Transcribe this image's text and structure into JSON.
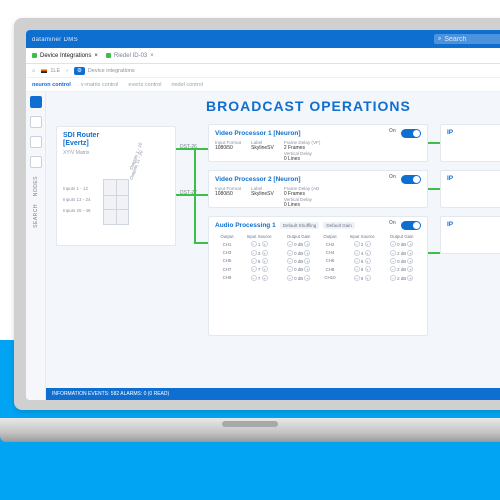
{
  "topbar": {
    "brand": "dataminer",
    "suite": "DMS",
    "search_placeholder": "Search",
    "square_icon": "□"
  },
  "tabs": [
    {
      "label": "Device Integrations",
      "close": "×"
    },
    {
      "label": "Riedel ID-03",
      "close": "×"
    }
  ],
  "crumbs": {
    "home": "⌂",
    "flag": "1LE",
    "badge_icon": "⚙",
    "badge": "Device integrations"
  },
  "subnav": [
    "neuron control",
    "v-matrix control",
    "evertz control",
    "riedel control"
  ],
  "rail": {
    "items": [
      "1",
      "2",
      "3",
      "4"
    ],
    "vertical1": "NODES",
    "vertical2": "SEARCH"
  },
  "headline": "BROADCAST OPERATIONS",
  "sdi": {
    "title": "SDI Router",
    "vendor": "[Evertz]",
    "sub": "XY\\V Matrix",
    "inputs": [
      "Inputs 1 - 12",
      "Inputs 13 - 24",
      "Inputs 25 - 48"
    ],
    "outputs": [
      "Outputs 1 - 10",
      "Outputs 11 - 20"
    ]
  },
  "dst": [
    "DST-26",
    "DST-27"
  ],
  "video": [
    {
      "title": "Video Processor 1 [Neuron]",
      "on": "On",
      "format_h": "Input Format",
      "format": "1080i50",
      "label_h": "Label",
      "label": "SkylineSV",
      "delay_h": "Frame Delay (VF)",
      "delay": "2 Frames",
      "vd_h": "Vertical Delay",
      "vd": "0 Lines"
    },
    {
      "title": "Video Processor 2 [Neuron]",
      "on": "On",
      "format_h": "Input Format",
      "format": "1080i50",
      "label_h": "Label",
      "label": "SkylineSV",
      "delay_h": "Frame Delay (AD",
      "delay": "0 Frames",
      "vd_h": "Vertical Delay",
      "vd": "0 Lines"
    }
  ],
  "ip": [
    {
      "title": "IP"
    },
    {
      "title": "IP"
    },
    {
      "title": "IP"
    }
  ],
  "audio": {
    "title": "Audio Processing 1",
    "btn1": "Default Shuffling",
    "btn2": "Default Gain",
    "on": "On",
    "headers": [
      "Output",
      "Input Source",
      "Output Gain",
      "Output",
      "Input Source",
      "Output Gain"
    ],
    "rows": [
      [
        "CH1",
        "1",
        "0 dB",
        "CH2",
        "2",
        "0 dB"
      ],
      [
        "CH3",
        "3",
        "0 dB",
        "CH4",
        "4",
        "2 dB"
      ],
      [
        "CH5",
        "5",
        "0 dB",
        "CH6",
        "6",
        "0 dB"
      ],
      [
        "CH7",
        "7",
        "0 dB",
        "CH8",
        "8",
        "2 dB"
      ],
      [
        "CH9",
        "7",
        "0 dB",
        "CH10",
        "8",
        "2 dB"
      ]
    ]
  },
  "footer": {
    "text": "INFORMATION EVENTS: 582 ALARMS: 0 (0 READ)"
  }
}
